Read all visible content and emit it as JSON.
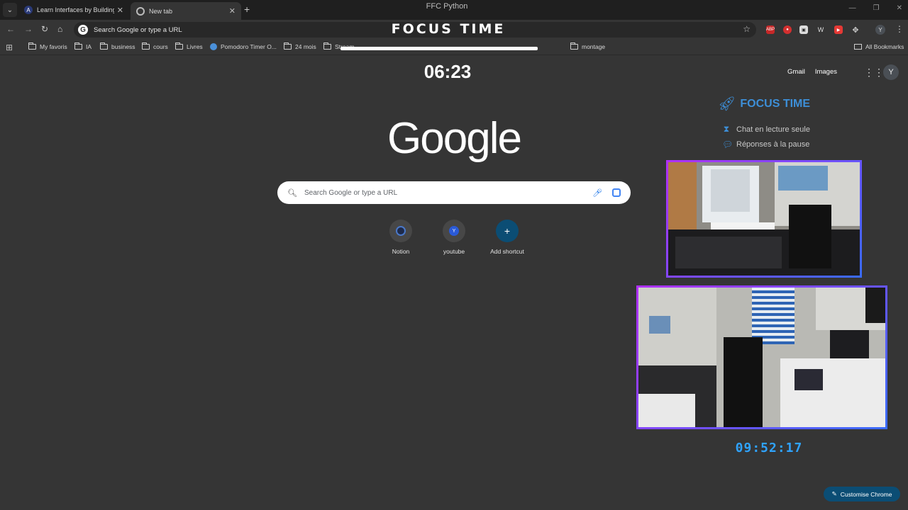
{
  "window": {
    "title": "FFC Python"
  },
  "tabs": [
    {
      "label": "Learn Interfaces by Building an",
      "favicon": "A"
    },
    {
      "label": "New tab",
      "favicon": "chrome-icon"
    }
  ],
  "toolbar": {
    "omnibox_text": "Search Google or type a URL",
    "overlay_banner": "FOCUS TIME",
    "profile_initial": "Y"
  },
  "bookmarks": {
    "items": [
      {
        "label": "My favoris",
        "icon": "folder-icon"
      },
      {
        "label": "IA",
        "icon": "folder-icon"
      },
      {
        "label": "business",
        "icon": "folder-icon"
      },
      {
        "label": "cours",
        "icon": "folder-icon"
      },
      {
        "label": "Livres",
        "icon": "folder-icon"
      },
      {
        "label": "Pomodoro Timer O...",
        "icon": "pomodoro-icon"
      },
      {
        "label": "24 mois",
        "icon": "folder-icon"
      },
      {
        "label": "Stream",
        "icon": "folder-icon"
      },
      {
        "label": "montage",
        "icon": "folder-icon"
      }
    ],
    "all_label": "All Bookmarks"
  },
  "ntp": {
    "timer": "06:23",
    "gmail_label": "Gmail",
    "images_label": "Images",
    "avatar_initial": "Y",
    "logo_text": "Google",
    "search_placeholder": "Search Google or type a URL",
    "shortcuts": [
      {
        "label": "Notion",
        "icon": "notion-icon"
      },
      {
        "label": "youtube",
        "icon": "Y"
      },
      {
        "label": "Add shortcut",
        "icon": "+"
      }
    ],
    "customize_label": "Customise Chrome"
  },
  "focus_panel": {
    "title": "FOCUS TIME",
    "rows": [
      {
        "icon": "hourglass-icon",
        "label": "Chat en lecture seule"
      },
      {
        "icon": "chat-bubble-icon",
        "label": "Réponses à la pause"
      }
    ],
    "clock": "09:52:17",
    "accent_color": "#3d8fd8",
    "clock_color": "#2fa3ff",
    "cam_border_color": "#a020f0"
  }
}
